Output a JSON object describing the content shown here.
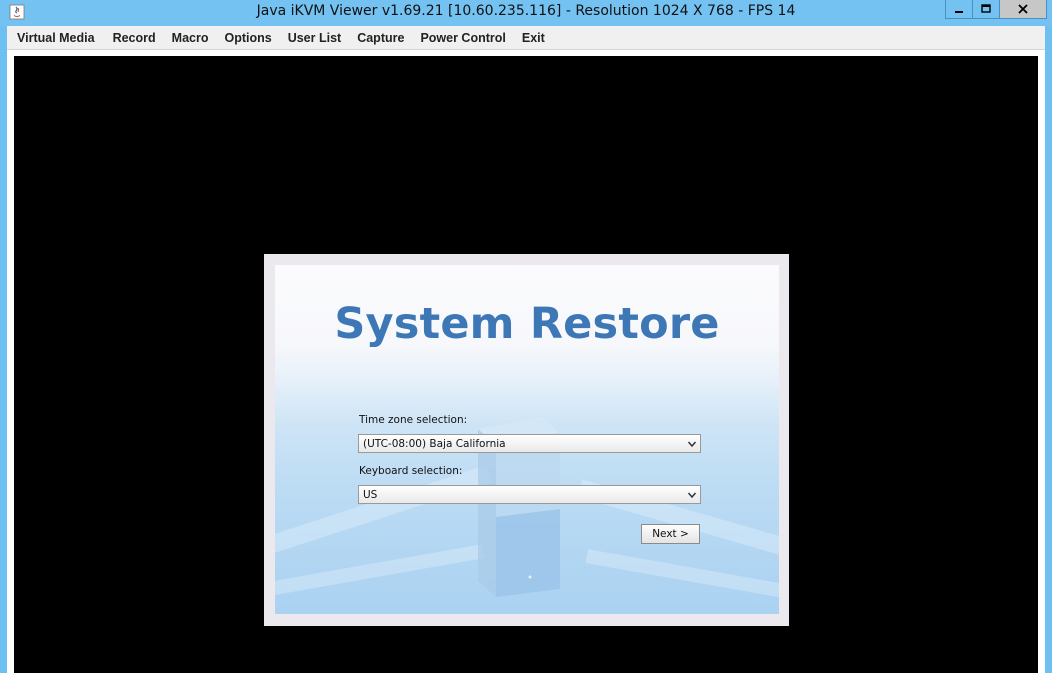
{
  "window": {
    "title": "Java iKVM Viewer v1.69.21 [10.60.235.116]  - Resolution 1024 X 768 - FPS 14",
    "app_icon": "java-icon",
    "controls": [
      "minimize-icon",
      "maximize-icon",
      "close-icon"
    ]
  },
  "menubar": {
    "items": [
      "Virtual Media",
      "Record",
      "Macro",
      "Options",
      "User List",
      "Capture",
      "Power Control",
      "Exit"
    ]
  },
  "dialog": {
    "heading": "System Restore",
    "timezone_label": "Time zone selection:",
    "timezone_value": "(UTC-08:00) Baja California",
    "keyboard_label": "Keyboard selection:",
    "keyboard_value": "US",
    "next_label": "Next >",
    "heading_color": "#3d77b6"
  }
}
